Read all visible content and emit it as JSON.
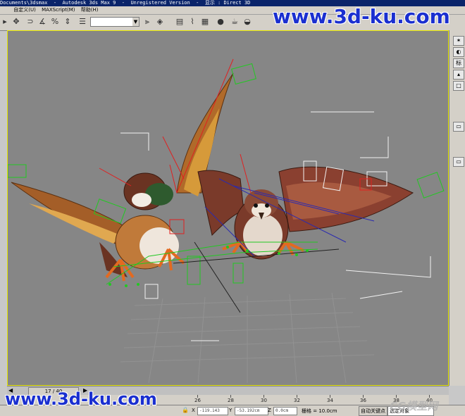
{
  "window": {
    "title_path": "Documents\\3dsmax",
    "title_app": "Autodesk 3ds Max 9",
    "title_status": "Unregistered Version",
    "title_display": "显示 : Direct 3D"
  },
  "menu": {
    "items": [
      "自定义(U)",
      "MAXScript(M)",
      "帮助(H)"
    ]
  },
  "toolbar": {
    "selection_set_value": ""
  },
  "viewport": {
    "scene": "two rigged sparrow models with bone and biped helpers",
    "border_color": "#e6e600",
    "background_color": "#868686"
  },
  "command_panel": {
    "label_1": "标"
  },
  "timeline": {
    "frame_label": "17 / 40",
    "ticks": [
      "26",
      "28",
      "30",
      "32",
      "34",
      "36",
      "38",
      "40"
    ]
  },
  "status": {
    "x_label": "X",
    "x_value": "-119.143",
    "y_label": "Y",
    "y_value": "-53.192cm",
    "z_label": "Z",
    "z_value": "0.0cm",
    "grid_label": "栅格 = 10.0cm",
    "autokey_label": "自动关键点",
    "selected_label": "选定对象"
  },
  "watermarks": {
    "top": "www.3d-ku.com",
    "bottom": "www.3d-ku.com",
    "cg": "CG模型网"
  },
  "colors": {
    "title_bg": "#0a246a",
    "ui_gray": "#d4d0c8",
    "watermark_blue": "#1a2fd0"
  }
}
